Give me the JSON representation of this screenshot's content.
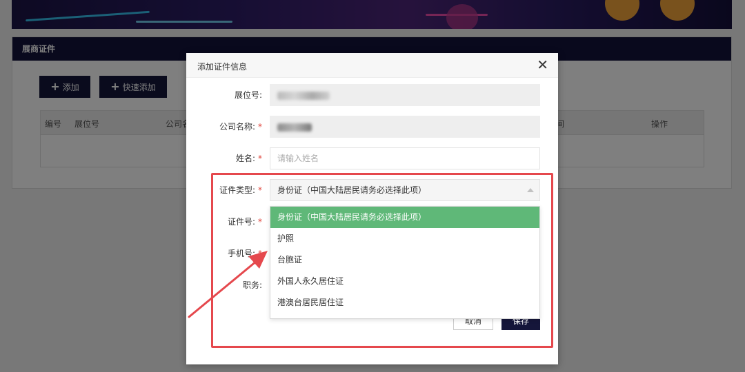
{
  "page": {
    "panel_title": "展商证件",
    "add_button_label": "添加",
    "quick_add_button_label": "快速添加",
    "table_headers": [
      "编号",
      "展位号",
      "公司名",
      "间",
      "操作"
    ]
  },
  "modal": {
    "title": "添加证件信息",
    "close_icon": "close-icon",
    "fields": {
      "booth": {
        "label": "展位号:"
      },
      "company": {
        "label": "公司名称:",
        "required_mark": "*"
      },
      "name": {
        "label": "姓名:",
        "required_mark": "*",
        "placeholder": "请输入姓名"
      },
      "id_type": {
        "label": "证件类型:",
        "required_mark": "*",
        "value": "身份证（中国大陆居民请务必选择此项）"
      },
      "id_number": {
        "label": "证件号:",
        "required_mark": "*"
      },
      "phone": {
        "label": "手机号:",
        "required_mark": "*"
      },
      "position": {
        "label": "职务:"
      }
    },
    "dropdown_options": [
      "身份证（中国大陆居民请务必选择此项）",
      "护照",
      "台胞证",
      "外国人永久居住证",
      "港澳台居民居住证"
    ],
    "selected_index": 0,
    "cancel_label": "取消",
    "save_label": "保存"
  },
  "colors": {
    "selected_option": "#5fb878",
    "annotation": "#e5484d",
    "dark_button": "#14163a"
  }
}
